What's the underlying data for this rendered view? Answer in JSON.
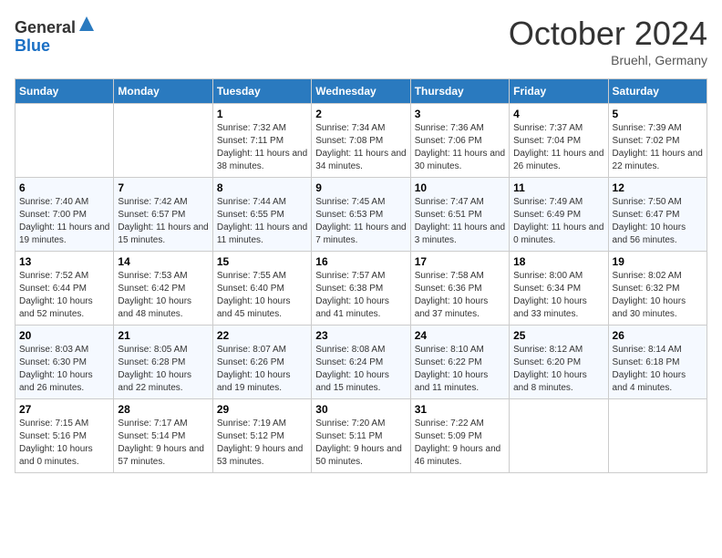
{
  "header": {
    "logo_line1": "General",
    "logo_line2": "Blue",
    "month_title": "October 2024",
    "location": "Bruehl, Germany"
  },
  "weekdays": [
    "Sunday",
    "Monday",
    "Tuesday",
    "Wednesday",
    "Thursday",
    "Friday",
    "Saturday"
  ],
  "weeks": [
    [
      {
        "day": "",
        "sunrise": "",
        "sunset": "",
        "daylight": ""
      },
      {
        "day": "",
        "sunrise": "",
        "sunset": "",
        "daylight": ""
      },
      {
        "day": "1",
        "sunrise": "Sunrise: 7:32 AM",
        "sunset": "Sunset: 7:11 PM",
        "daylight": "Daylight: 11 hours and 38 minutes."
      },
      {
        "day": "2",
        "sunrise": "Sunrise: 7:34 AM",
        "sunset": "Sunset: 7:08 PM",
        "daylight": "Daylight: 11 hours and 34 minutes."
      },
      {
        "day": "3",
        "sunrise": "Sunrise: 7:36 AM",
        "sunset": "Sunset: 7:06 PM",
        "daylight": "Daylight: 11 hours and 30 minutes."
      },
      {
        "day": "4",
        "sunrise": "Sunrise: 7:37 AM",
        "sunset": "Sunset: 7:04 PM",
        "daylight": "Daylight: 11 hours and 26 minutes."
      },
      {
        "day": "5",
        "sunrise": "Sunrise: 7:39 AM",
        "sunset": "Sunset: 7:02 PM",
        "daylight": "Daylight: 11 hours and 22 minutes."
      }
    ],
    [
      {
        "day": "6",
        "sunrise": "Sunrise: 7:40 AM",
        "sunset": "Sunset: 7:00 PM",
        "daylight": "Daylight: 11 hours and 19 minutes."
      },
      {
        "day": "7",
        "sunrise": "Sunrise: 7:42 AM",
        "sunset": "Sunset: 6:57 PM",
        "daylight": "Daylight: 11 hours and 15 minutes."
      },
      {
        "day": "8",
        "sunrise": "Sunrise: 7:44 AM",
        "sunset": "Sunset: 6:55 PM",
        "daylight": "Daylight: 11 hours and 11 minutes."
      },
      {
        "day": "9",
        "sunrise": "Sunrise: 7:45 AM",
        "sunset": "Sunset: 6:53 PM",
        "daylight": "Daylight: 11 hours and 7 minutes."
      },
      {
        "day": "10",
        "sunrise": "Sunrise: 7:47 AM",
        "sunset": "Sunset: 6:51 PM",
        "daylight": "Daylight: 11 hours and 3 minutes."
      },
      {
        "day": "11",
        "sunrise": "Sunrise: 7:49 AM",
        "sunset": "Sunset: 6:49 PM",
        "daylight": "Daylight: 11 hours and 0 minutes."
      },
      {
        "day": "12",
        "sunrise": "Sunrise: 7:50 AM",
        "sunset": "Sunset: 6:47 PM",
        "daylight": "Daylight: 10 hours and 56 minutes."
      }
    ],
    [
      {
        "day": "13",
        "sunrise": "Sunrise: 7:52 AM",
        "sunset": "Sunset: 6:44 PM",
        "daylight": "Daylight: 10 hours and 52 minutes."
      },
      {
        "day": "14",
        "sunrise": "Sunrise: 7:53 AM",
        "sunset": "Sunset: 6:42 PM",
        "daylight": "Daylight: 10 hours and 48 minutes."
      },
      {
        "day": "15",
        "sunrise": "Sunrise: 7:55 AM",
        "sunset": "Sunset: 6:40 PM",
        "daylight": "Daylight: 10 hours and 45 minutes."
      },
      {
        "day": "16",
        "sunrise": "Sunrise: 7:57 AM",
        "sunset": "Sunset: 6:38 PM",
        "daylight": "Daylight: 10 hours and 41 minutes."
      },
      {
        "day": "17",
        "sunrise": "Sunrise: 7:58 AM",
        "sunset": "Sunset: 6:36 PM",
        "daylight": "Daylight: 10 hours and 37 minutes."
      },
      {
        "day": "18",
        "sunrise": "Sunrise: 8:00 AM",
        "sunset": "Sunset: 6:34 PM",
        "daylight": "Daylight: 10 hours and 33 minutes."
      },
      {
        "day": "19",
        "sunrise": "Sunrise: 8:02 AM",
        "sunset": "Sunset: 6:32 PM",
        "daylight": "Daylight: 10 hours and 30 minutes."
      }
    ],
    [
      {
        "day": "20",
        "sunrise": "Sunrise: 8:03 AM",
        "sunset": "Sunset: 6:30 PM",
        "daylight": "Daylight: 10 hours and 26 minutes."
      },
      {
        "day": "21",
        "sunrise": "Sunrise: 8:05 AM",
        "sunset": "Sunset: 6:28 PM",
        "daylight": "Daylight: 10 hours and 22 minutes."
      },
      {
        "day": "22",
        "sunrise": "Sunrise: 8:07 AM",
        "sunset": "Sunset: 6:26 PM",
        "daylight": "Daylight: 10 hours and 19 minutes."
      },
      {
        "day": "23",
        "sunrise": "Sunrise: 8:08 AM",
        "sunset": "Sunset: 6:24 PM",
        "daylight": "Daylight: 10 hours and 15 minutes."
      },
      {
        "day": "24",
        "sunrise": "Sunrise: 8:10 AM",
        "sunset": "Sunset: 6:22 PM",
        "daylight": "Daylight: 10 hours and 11 minutes."
      },
      {
        "day": "25",
        "sunrise": "Sunrise: 8:12 AM",
        "sunset": "Sunset: 6:20 PM",
        "daylight": "Daylight: 10 hours and 8 minutes."
      },
      {
        "day": "26",
        "sunrise": "Sunrise: 8:14 AM",
        "sunset": "Sunset: 6:18 PM",
        "daylight": "Daylight: 10 hours and 4 minutes."
      }
    ],
    [
      {
        "day": "27",
        "sunrise": "Sunrise: 7:15 AM",
        "sunset": "Sunset: 5:16 PM",
        "daylight": "Daylight: 10 hours and 0 minutes."
      },
      {
        "day": "28",
        "sunrise": "Sunrise: 7:17 AM",
        "sunset": "Sunset: 5:14 PM",
        "daylight": "Daylight: 9 hours and 57 minutes."
      },
      {
        "day": "29",
        "sunrise": "Sunrise: 7:19 AM",
        "sunset": "Sunset: 5:12 PM",
        "daylight": "Daylight: 9 hours and 53 minutes."
      },
      {
        "day": "30",
        "sunrise": "Sunrise: 7:20 AM",
        "sunset": "Sunset: 5:11 PM",
        "daylight": "Daylight: 9 hours and 50 minutes."
      },
      {
        "day": "31",
        "sunrise": "Sunrise: 7:22 AM",
        "sunset": "Sunset: 5:09 PM",
        "daylight": "Daylight: 9 hours and 46 minutes."
      },
      {
        "day": "",
        "sunrise": "",
        "sunset": "",
        "daylight": ""
      },
      {
        "day": "",
        "sunrise": "",
        "sunset": "",
        "daylight": ""
      }
    ]
  ]
}
